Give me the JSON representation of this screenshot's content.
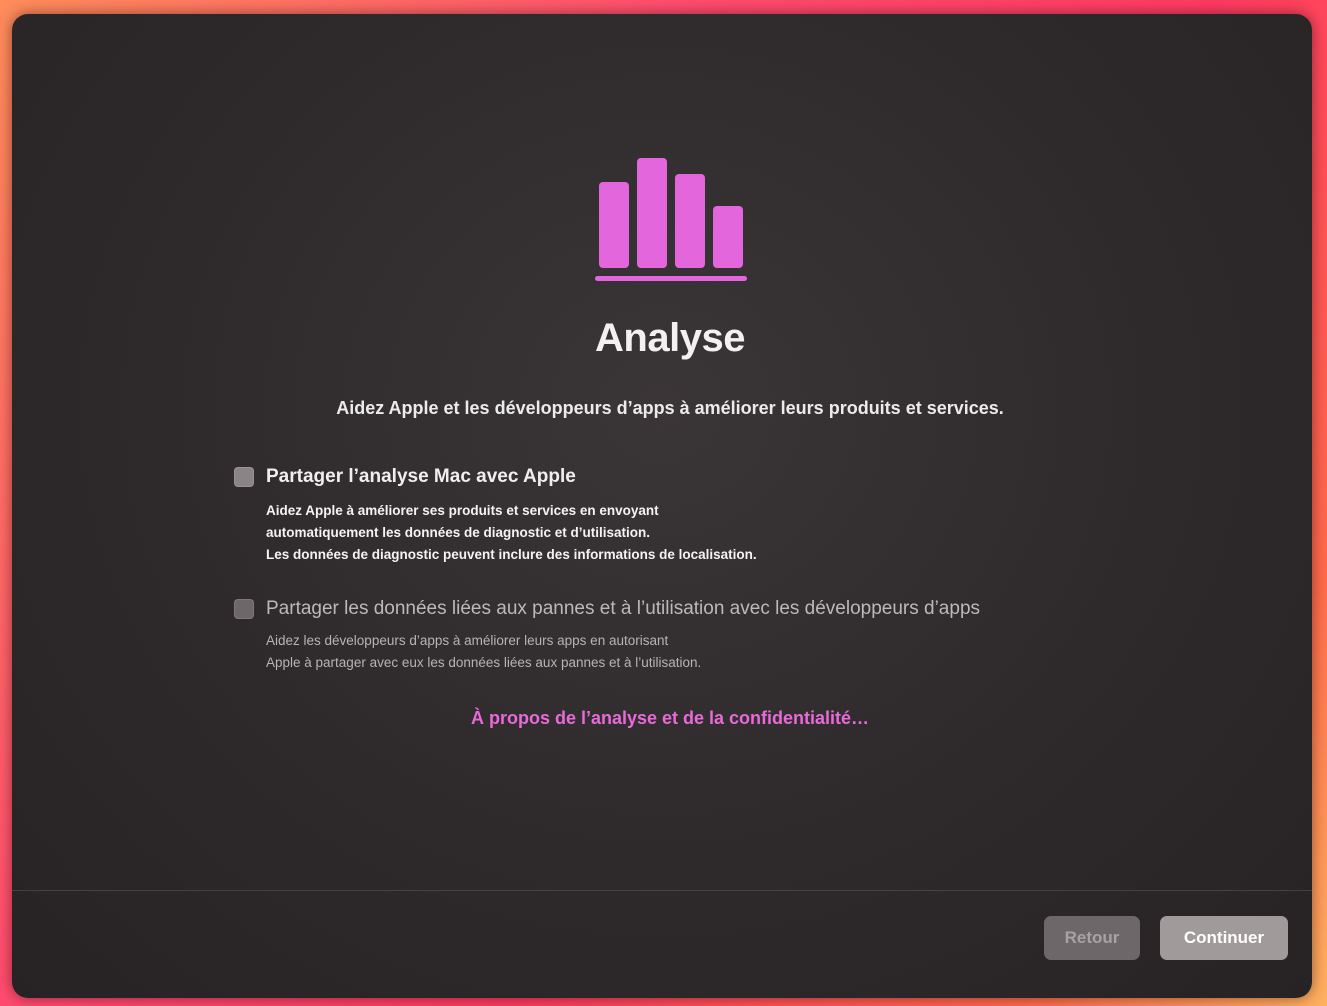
{
  "window": {
    "title": "Analyse",
    "subtitle": "Aidez Apple et les développeurs d’apps à améliorer leurs produits et services."
  },
  "hero_icon": {
    "name": "analytics-bars-icon",
    "color": "#e466dc"
  },
  "options": [
    {
      "label": "Partager l’analyse Mac avec Apple",
      "checked": false,
      "description": [
        "Aidez Apple à améliorer ses produits et services en envoyant",
        "automatiquement les données de diagnostic et d’utilisation.",
        "Les données de diagnostic peuvent inclure des informations de localisation."
      ]
    },
    {
      "label": "Partager les données liées aux pannes et à l’utilisation avec les développeurs d’apps",
      "checked": false,
      "description": [
        "Aidez les développeurs d’apps à améliorer leurs apps en autorisant",
        "Apple à partager avec eux les données liées aux pannes et à l’utilisation."
      ]
    }
  ],
  "privacy_link": "À propos de l’analyse et de la confidentialité…",
  "buttons": {
    "back": "Retour",
    "continue": "Continuer"
  }
}
